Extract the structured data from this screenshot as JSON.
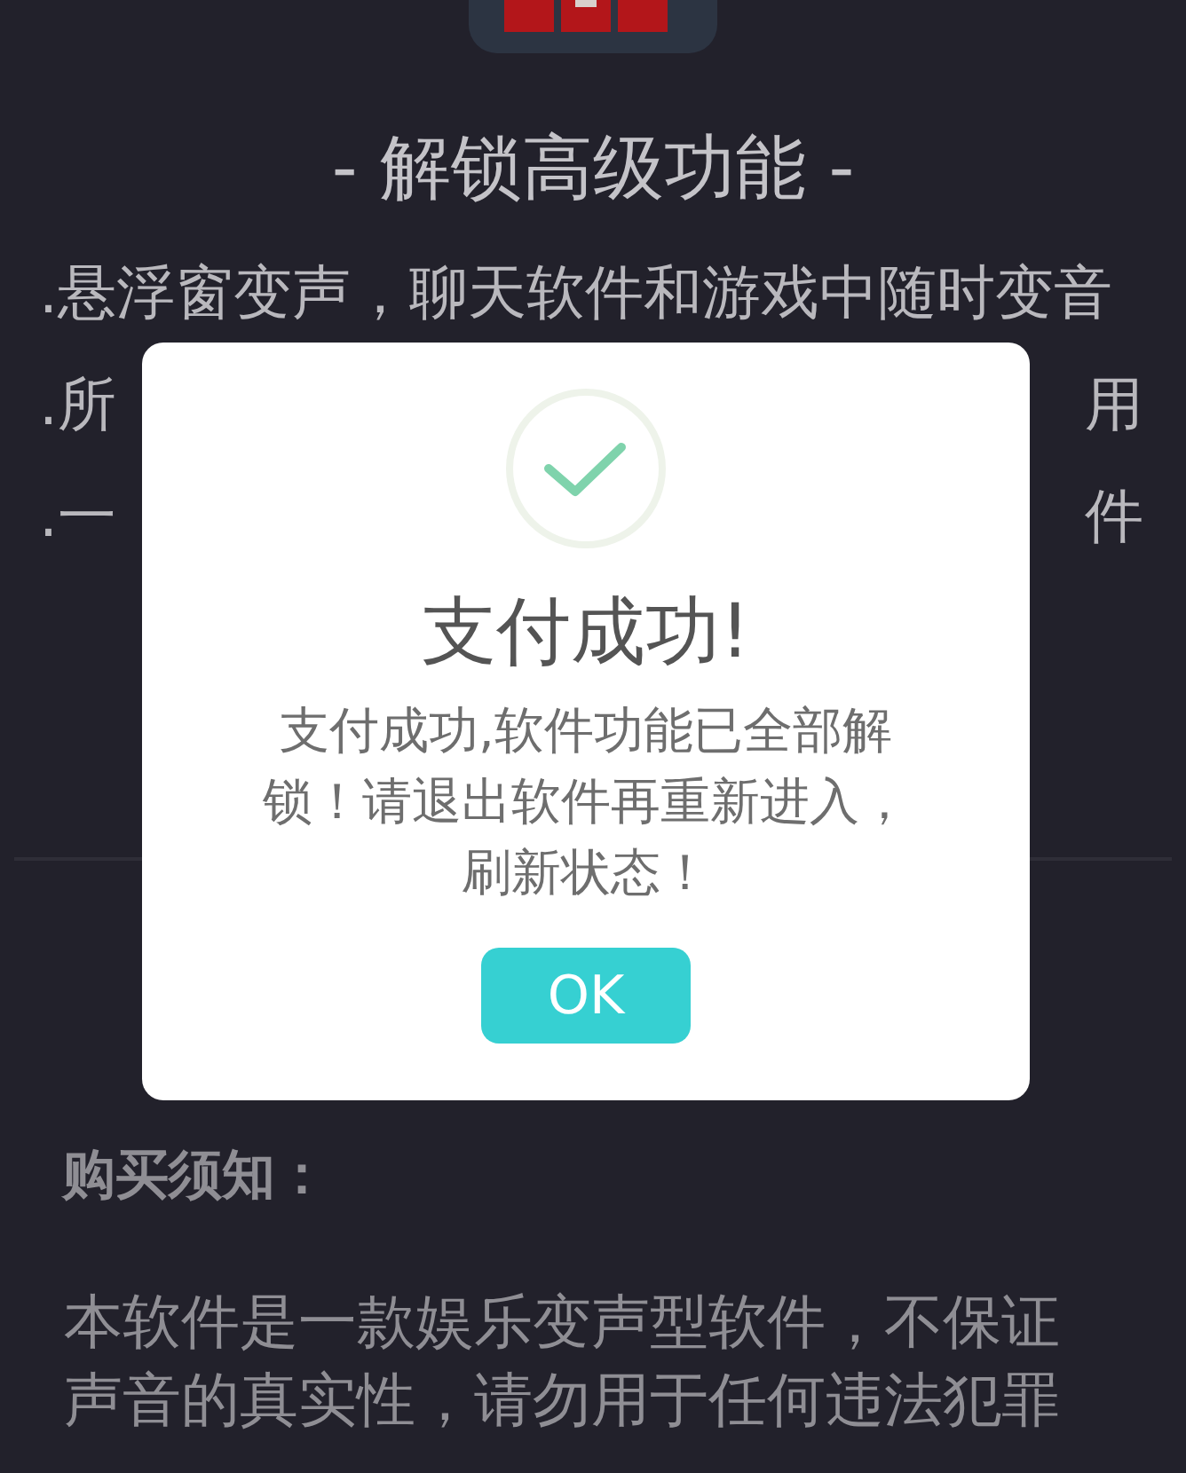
{
  "header": {
    "title": "- 解锁高级功能 -"
  },
  "features": [
    {
      "parts": [
        ".悬浮窗变声，聊天软件和游戏中随时变音"
      ]
    },
    {
      "parts": [
        ".所",
        "用"
      ]
    },
    {
      "parts": [
        ".一",
        "件"
      ]
    }
  ],
  "dialog": {
    "title": "支付成功!",
    "message_lines": [
      "支付成功,软件功能已全部解",
      "锁！请退出软件再重新进入，",
      "刷新状态！"
    ],
    "button": "OK"
  },
  "notice": {
    "heading": "购买须知：",
    "text_lines": [
      "本软件是一款娱乐变声型软件，不保证",
      "声音的真实性，请勿用于任何违法犯罪"
    ]
  }
}
